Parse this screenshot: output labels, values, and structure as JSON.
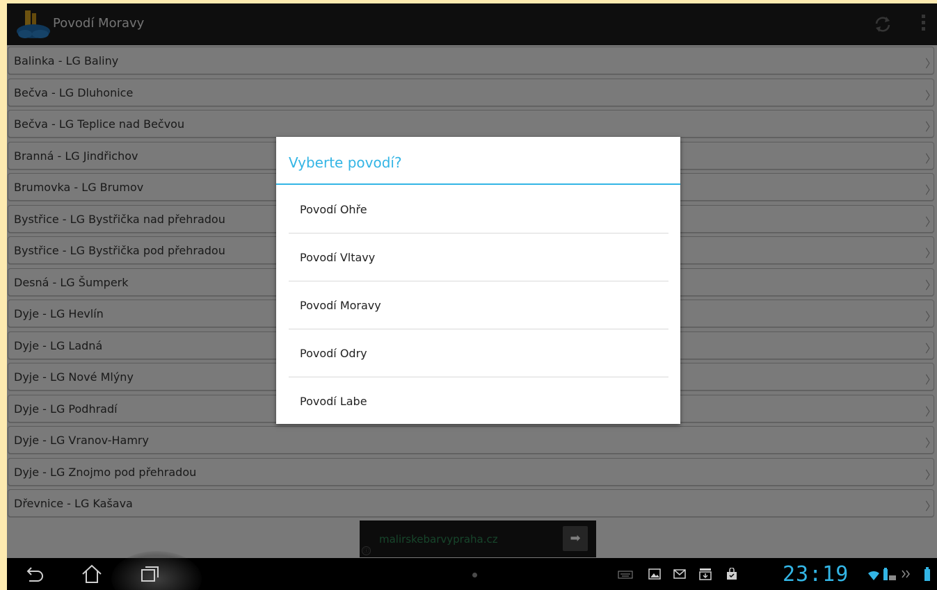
{
  "app": {
    "title": "Povodí Moravy"
  },
  "list": {
    "items": [
      "Balinka - LG Baliny",
      "Bečva - LG Dluhonice",
      "Bečva - LG Teplice nad Bečvou",
      "Branná - LG Jindřichov",
      "Brumovka - LG Brumov",
      "Bystřice - LG Bystřička nad přehradou",
      "Bystřice - LG Bystřička pod přehradou",
      "Desná - LG Šumperk",
      "Dyje - LG Hevlín",
      "Dyje - LG Ladná",
      "Dyje - LG Nové Mlýny",
      "Dyje - LG Podhradí",
      "Dyje - LG Vranov-Hamry",
      "Dyje - LG Znojmo pod přehradou",
      "Dřevnice - LG Kašava"
    ],
    "chevron": "〉"
  },
  "dialog": {
    "title": "Vyberte povodí?",
    "options": [
      "Povodí Ohře",
      "Povodí Vltavy",
      "Povodí Moravy",
      "Povodí Odry",
      "Povodí Labe"
    ]
  },
  "ad": {
    "text": "malirskebarvypraha.cz",
    "button": "➡",
    "info": "ⓘ"
  },
  "statusbar": {
    "time": "23:19"
  },
  "colors": {
    "accent": "#33b5e5",
    "actionbar": "#1c1c1c",
    "navbar": "#000000"
  },
  "icons": [
    "app-logo-icon",
    "refresh-icon",
    "overflow-menu-icon",
    "back-icon",
    "home-icon",
    "recent-apps-icon",
    "keyboard-icon",
    "gallery-icon",
    "gmail-icon",
    "download-icon",
    "store-icon",
    "wifi-icon",
    "battery-icon"
  ]
}
